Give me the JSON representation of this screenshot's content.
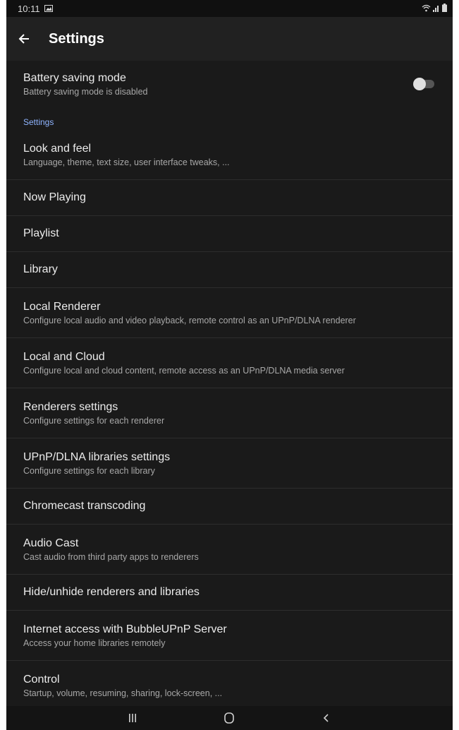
{
  "status_bar": {
    "time": "10:11"
  },
  "app_bar": {
    "title": "Settings"
  },
  "battery": {
    "title": "Battery saving mode",
    "subtitle": "Battery saving mode is disabled",
    "enabled": false
  },
  "section_header": "Settings",
  "items": [
    {
      "title": "Look and feel",
      "subtitle": "Language, theme, text size, user interface tweaks, ..."
    },
    {
      "title": "Now Playing",
      "subtitle": ""
    },
    {
      "title": "Playlist",
      "subtitle": ""
    },
    {
      "title": "Library",
      "subtitle": ""
    },
    {
      "title": "Local Renderer",
      "subtitle": "Configure local audio and video playback, remote control as an UPnP/DLNA renderer"
    },
    {
      "title": "Local and Cloud",
      "subtitle": "Configure local and cloud content, remote access as an UPnP/DLNA media server"
    },
    {
      "title": "Renderers settings",
      "subtitle": "Configure settings for each renderer"
    },
    {
      "title": "UPnP/DLNA libraries settings",
      "subtitle": "Configure settings for each library"
    },
    {
      "title": "Chromecast transcoding",
      "subtitle": ""
    },
    {
      "title": "Audio Cast",
      "subtitle": "Cast audio from third party apps to renderers"
    },
    {
      "title": "Hide/unhide renderers and libraries",
      "subtitle": ""
    },
    {
      "title": "Internet access with BubbleUPnP Server",
      "subtitle": "Access your home libraries remotely"
    },
    {
      "title": "Control",
      "subtitle": "Startup, volume, resuming, sharing, lock-screen, ..."
    }
  ],
  "icons": {
    "back": "arrow-left-icon",
    "gallery": "image-icon",
    "wifi": "wifi-icon",
    "signal": "signal-icon",
    "battery": "battery-icon",
    "recents": "recents-icon",
    "home": "home-icon",
    "nav_back": "chevron-left-icon"
  },
  "colors": {
    "background": "#1a1a1a",
    "app_bar": "#212121",
    "accent": "#8fb4ff"
  }
}
